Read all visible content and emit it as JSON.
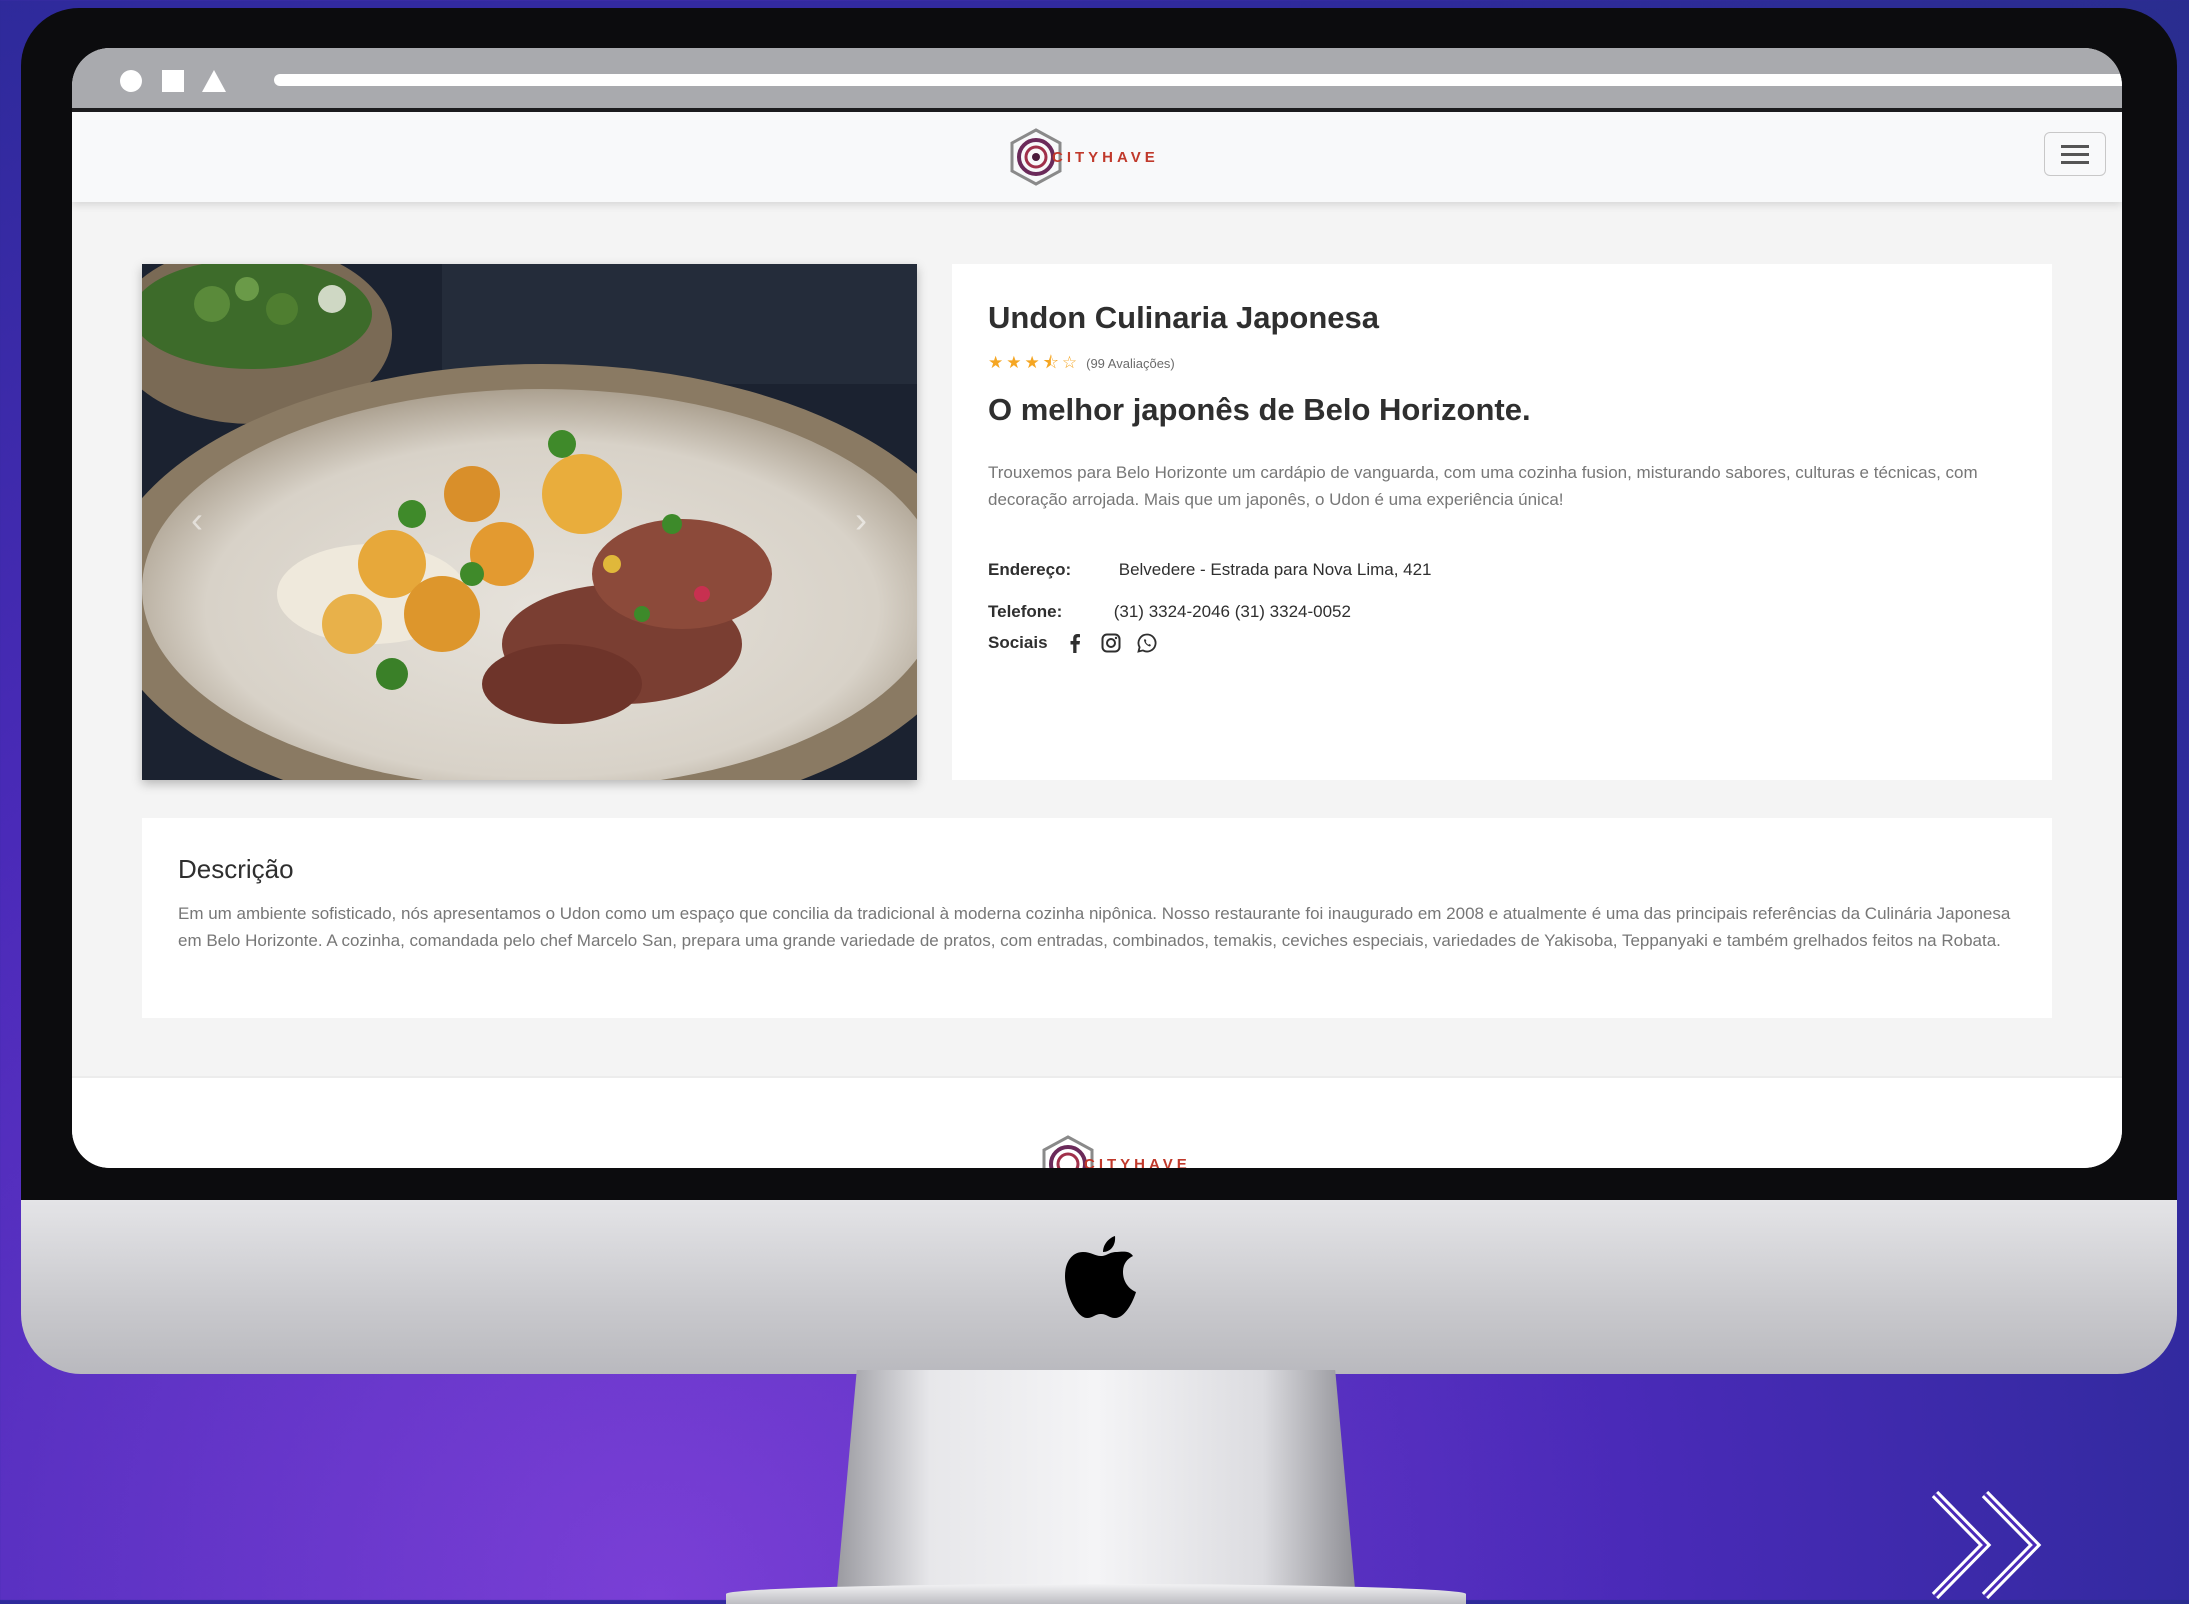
{
  "colors": {
    "accent_star": "#f5a623",
    "brand_red": "#c0392b",
    "background_purple": "#4a2ab8"
  },
  "navbar": {
    "brand_text": "CITYHAVE",
    "menu_icon": "hamburger-icon"
  },
  "carousel": {
    "prev_icon": "chevron-left-icon",
    "next_icon": "chevron-right-icon"
  },
  "restaurant": {
    "name": "Undon Culinaria Japonesa",
    "rating": 3.5,
    "rating_max": 5,
    "reviews_label": "(99 Avaliações)",
    "tagline": "O melhor japonês de Belo Horizonte.",
    "about": "Trouxemos para Belo Horizonte um cardápio de vanguarda, com uma cozinha fusion, misturando sabores, culturas e técnicas, com decoração arrojada. Mais que um japonês, o Udon é uma experiência única!",
    "address_label": "Endereço:",
    "address_value": "Belvedere - Estrada para Nova Lima, 421",
    "phone_label": "Telefone:",
    "phone_value": "(31) 3324-2046 (31) 3324-0052",
    "socials_label": "Sociais",
    "social_icons": [
      "facebook-icon",
      "instagram-icon",
      "whatsapp-icon"
    ]
  },
  "description": {
    "title": "Descrição",
    "text": "Em um ambiente sofisticado, nós apresentamos o Udon como um espaço que concilia da tradicional à moderna cozinha nipônica. Nosso restaurante foi inaugurado em 2008 e atualmente é uma das principais referências da Culinária Japonesa em Belo Horizonte. A cozinha, comandada pelo chef Marcelo San, prepara uma grande variedade de pratos, com entradas, combinados, temakis, ceviches especiais, variedades de Yakisoba, Teppanyaki e também grelhados feitos na Robata."
  },
  "footer": {
    "brand_text": "CITYHAVE"
  }
}
